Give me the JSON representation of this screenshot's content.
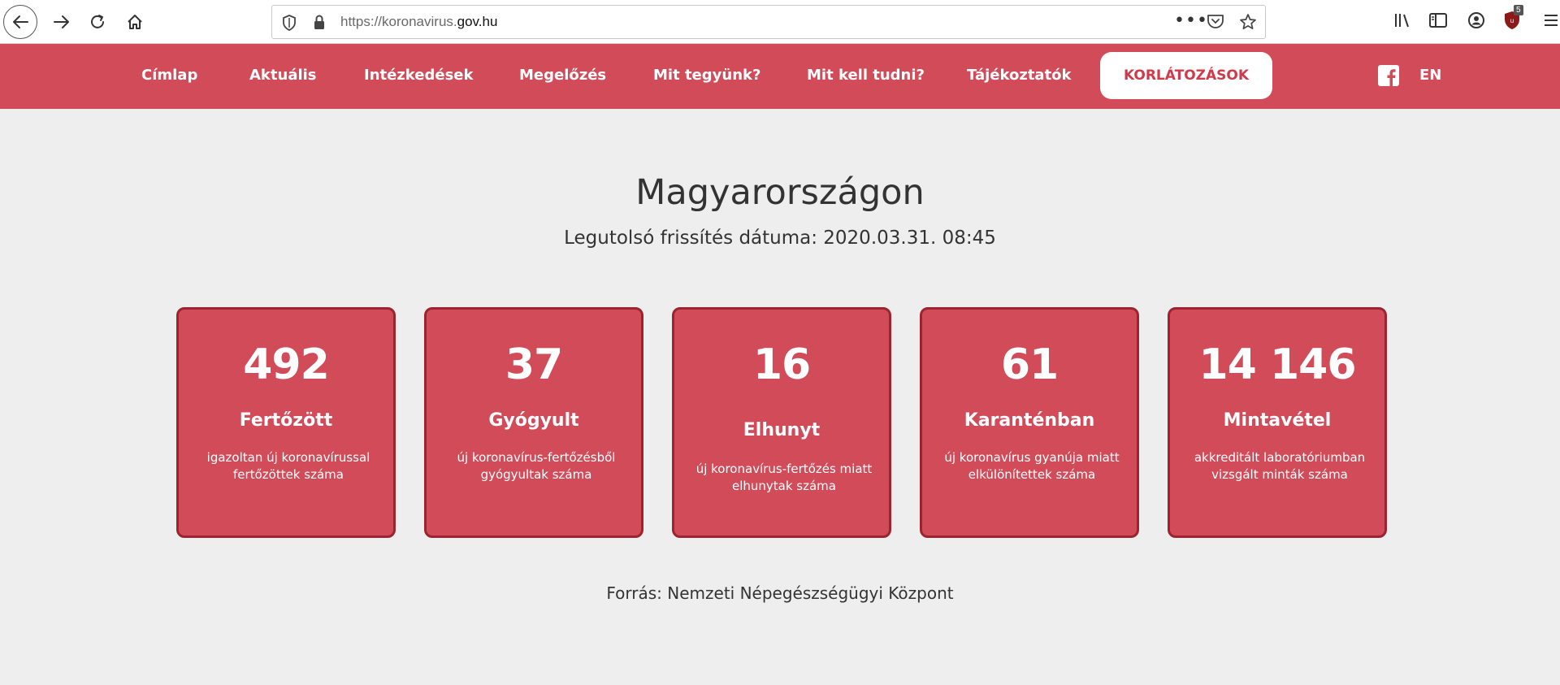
{
  "browser": {
    "url_scheme": "https://koronavirus.",
    "url_host": "gov.hu",
    "url_more": "•••",
    "ublock_badge": "5"
  },
  "nav": {
    "items": [
      "Címlap",
      "Aktuális",
      "Intézkedések",
      "Megelőzés",
      "Mit tegyünk?",
      "Mit kell tudni?",
      "Tájékoztatók"
    ],
    "highlight": "KORLÁTOZÁSOK",
    "language": "EN"
  },
  "main": {
    "title": "Magyarországon",
    "subtitle": "Legutolsó frissítés dátuma: 2020.03.31. 08:45",
    "source": "Forrás: Nemzeti Népegészségügyi Központ"
  },
  "stats": [
    {
      "number": "492",
      "label": "Fertőzött",
      "desc": "igazoltan új koronavírussal fertőzöttek száma"
    },
    {
      "number": "37",
      "label": "Gyógyult",
      "desc": "új koronavírus-fertőzésből gyógyultak száma"
    },
    {
      "number": "16",
      "label": "Elhunyt",
      "desc": "új koronavírus-fertőzés miatt elhunytak száma"
    },
    {
      "number": "61",
      "label": "Karanténban",
      "desc": "új koronavírus gyanúja miatt elkülönítettek száma"
    },
    {
      "number": "14 146",
      "label": "Mintavétel",
      "desc": "akkreditált laboratóriumban vizsgált minták száma"
    }
  ],
  "colors": {
    "accent": "#d14b59",
    "card_border": "#9b2430",
    "highlight_text": "#d03a4a",
    "background": "#eeeeee"
  },
  "icons": {
    "back": "arrow-left-icon",
    "forward": "arrow-right-icon",
    "reload": "reload-icon",
    "home": "home-icon",
    "shield": "shield-icon",
    "lock": "lock-icon",
    "pocket": "pocket-icon",
    "star": "star-icon",
    "library": "library-icon",
    "sidebar": "sidebar-icon",
    "account": "account-icon",
    "ublock": "ublock-icon",
    "menu": "hamburger-menu-icon",
    "facebook": "facebook-icon"
  }
}
